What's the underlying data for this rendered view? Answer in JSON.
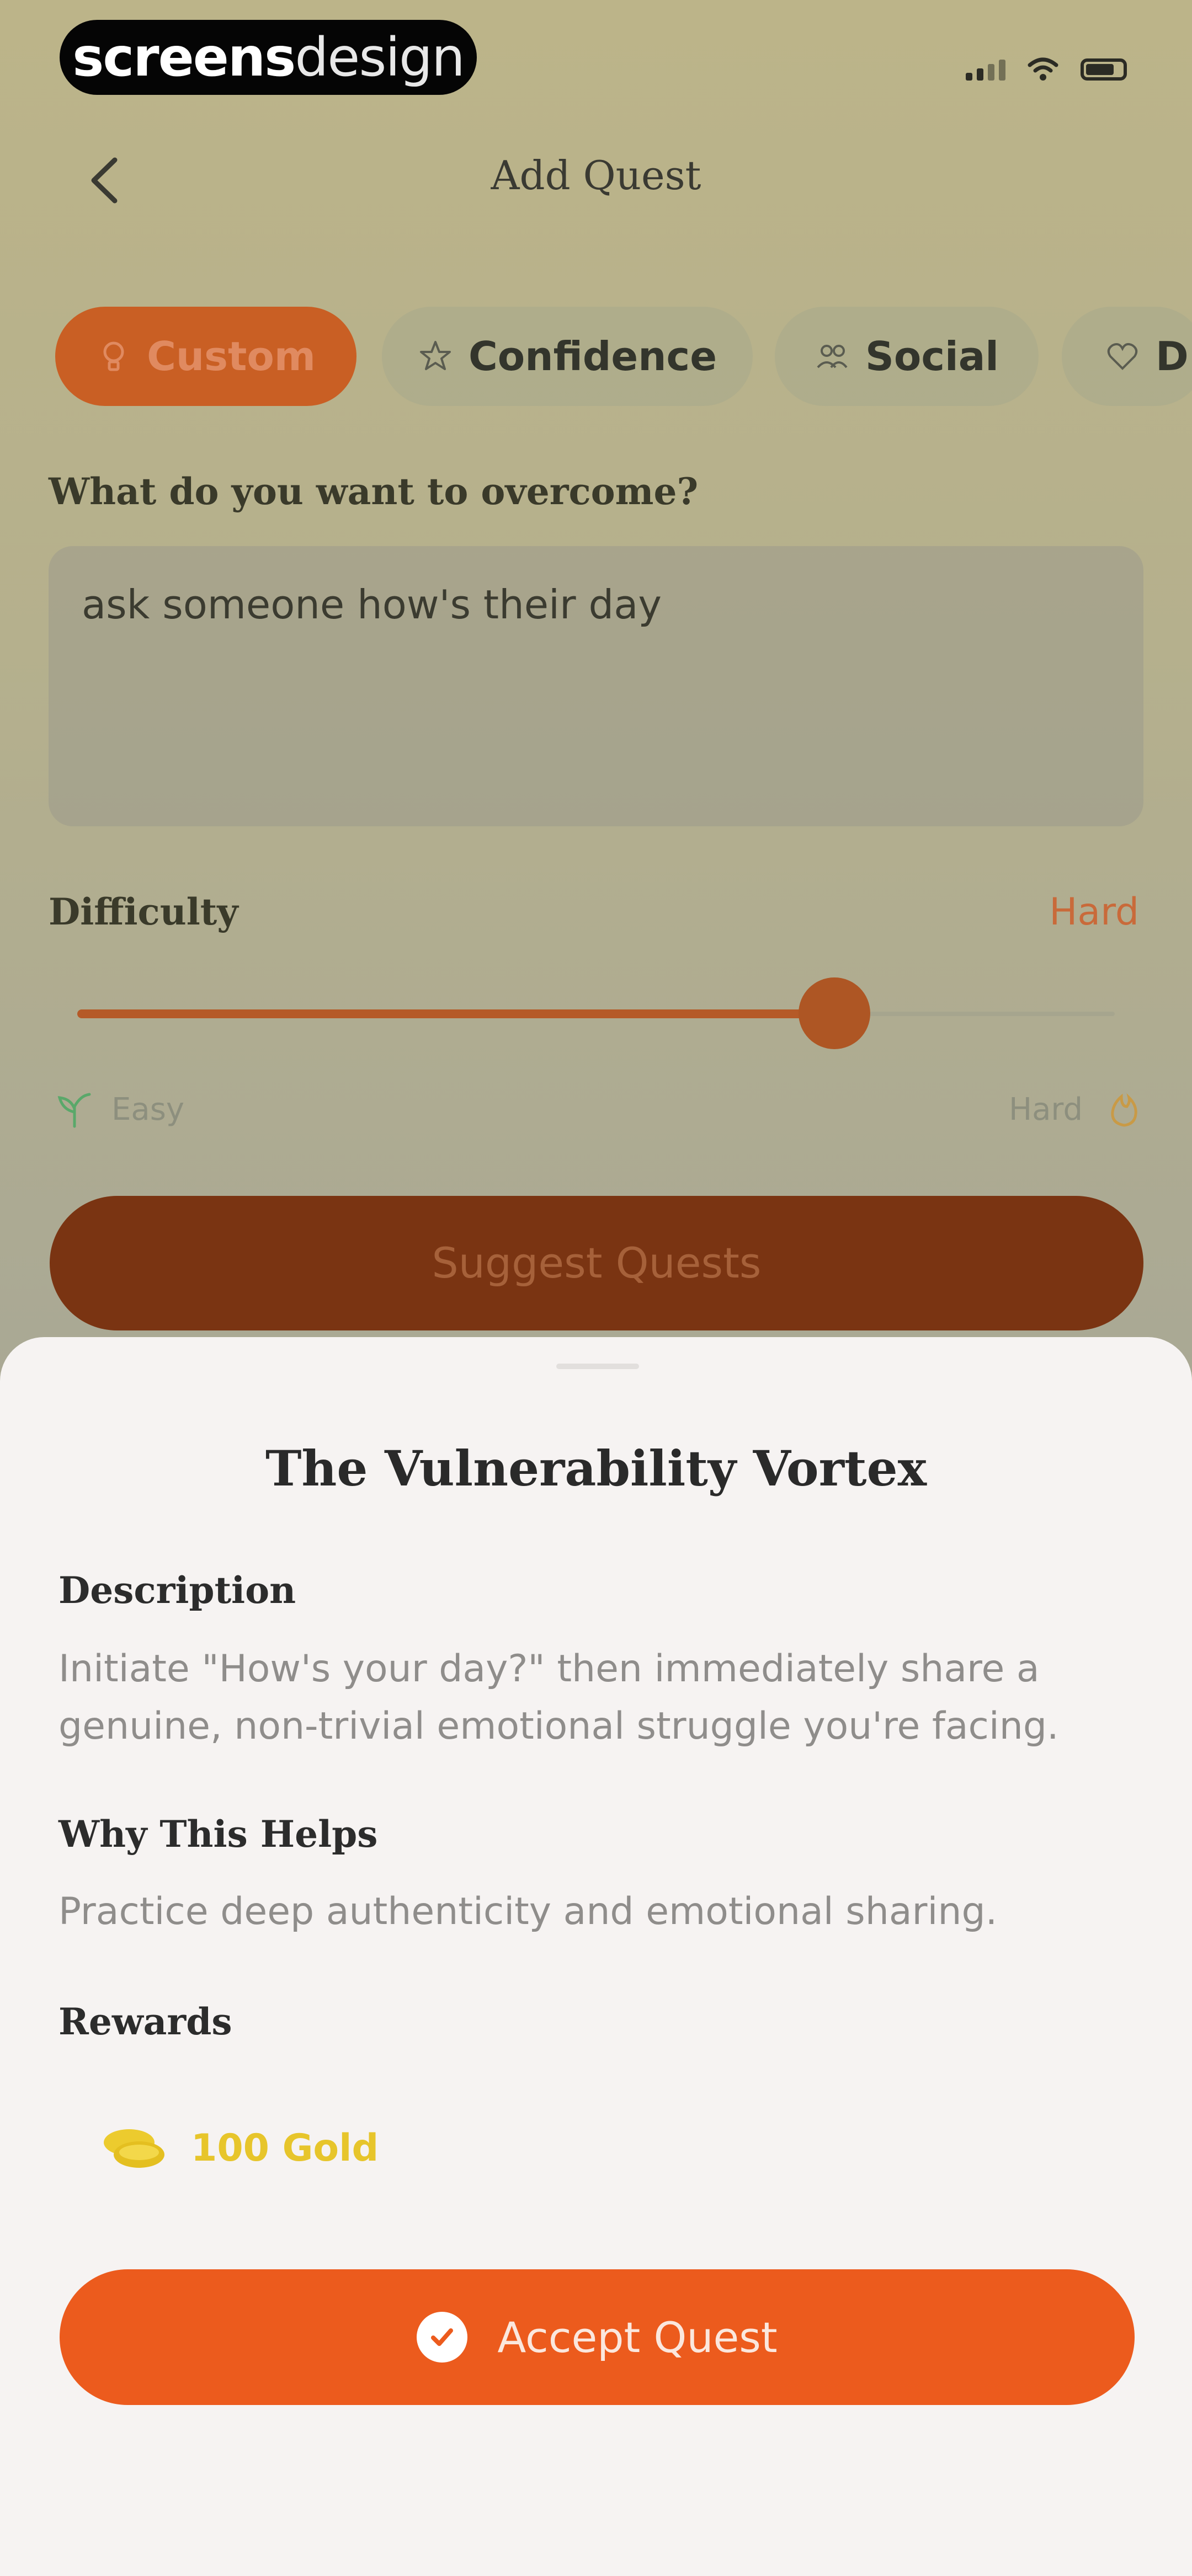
{
  "status_bar": {
    "badge_bold": "screens",
    "badge_light": "design"
  },
  "header": {
    "title": "Add Quest"
  },
  "chips": [
    {
      "label": "Custom",
      "icon": "lightbulb-icon"
    },
    {
      "label": "Confidence",
      "icon": "star-icon"
    },
    {
      "label": "Social",
      "icon": "people-icon"
    },
    {
      "label": "D",
      "icon": "heart-icon"
    }
  ],
  "form": {
    "prompt_label": "What do you want to overcome?",
    "input_value": "ask someone how's their day",
    "difficulty_label": "Difficulty",
    "difficulty_value": "Hard",
    "difficulty_level": 0.73,
    "easy_label": "Easy",
    "hard_label": "Hard",
    "suggest_button": "Suggest Quests"
  },
  "sheet": {
    "title": "The Vulnerability Vortex",
    "description_heading": "Description",
    "description_text": "Initiate \"How's your day?\" then immediately share a genuine, non-trivial emotional struggle you're facing.",
    "why_heading": "Why This Helps",
    "why_text": "Practice deep authenticity and emotional sharing.",
    "rewards_heading": "Rewards",
    "reward_text": "100 Gold",
    "accept_button": "Accept Quest"
  },
  "colors": {
    "accent": "#ec5b1d",
    "gold": "#e7c52b",
    "sheet_bg": "#f6f3f2"
  }
}
